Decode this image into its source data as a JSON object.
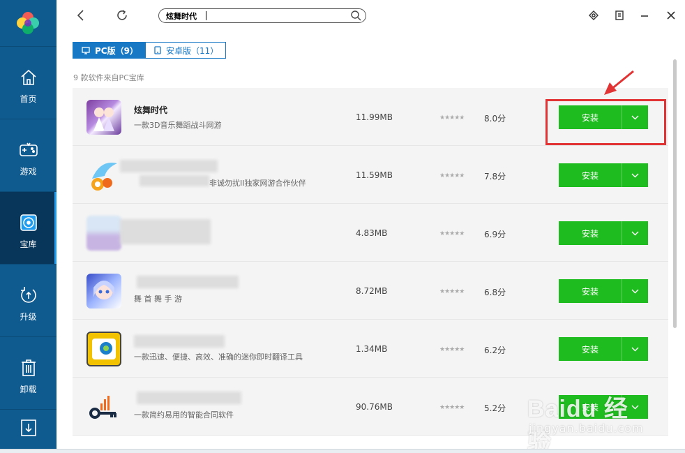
{
  "colors": {
    "sidebar": "#0f5a8f",
    "sidebar_active": "#08365a",
    "accent_blue": "#1778c6",
    "install_green": "#1fbc1f",
    "annotation_red": "#e13333"
  },
  "sidebar": {
    "logo_icon": "app-logo-icon",
    "items": [
      {
        "label": "首页",
        "icon": "home-icon",
        "active": false
      },
      {
        "label": "游戏",
        "icon": "gamepad-icon",
        "active": false
      },
      {
        "label": "宝库",
        "icon": "disc-icon",
        "active": true
      },
      {
        "label": "升级",
        "icon": "upgrade-icon",
        "active": false
      },
      {
        "label": "卸载",
        "icon": "trash-icon",
        "active": false
      },
      {
        "label": "",
        "icon": "download-icon",
        "active": false
      }
    ]
  },
  "topbar": {
    "back_icon": "chevron-left-icon",
    "refresh_icon": "refresh-icon",
    "search_value": "炫舞时代",
    "search_icon": "search-icon",
    "right_icons": [
      "network-icon",
      "skin-icon",
      "minimize-icon",
      "close-icon"
    ]
  },
  "tabs": [
    {
      "label": "PC版（9）",
      "icon": "monitor-icon",
      "active": true
    },
    {
      "label": "安卓版（11）",
      "icon": "phone-icon",
      "active": false
    }
  ],
  "source_line": "9 款软件来自PC宝库",
  "apps": [
    {
      "name": "炫舞时代",
      "desc": "一款3D音乐舞蹈战斗网游",
      "size": "11.99MB",
      "stars": "★★★★★",
      "score": "8.0分",
      "install": "安装"
    },
    {
      "name": "",
      "desc": "非诚勿扰II独家网游合作伙伴",
      "size": "11.59MB",
      "stars": "★★★★★",
      "score": "7.8分",
      "install": "安装"
    },
    {
      "name": "",
      "desc": "",
      "size": "4.83MB",
      "stars": "★★★★★",
      "score": "6.9分",
      "install": "安装"
    },
    {
      "name": "",
      "desc": "舞   首 舞 手 游",
      "size": "8.72MB",
      "stars": "★★★★★",
      "score": "6.8分",
      "install": "安装"
    },
    {
      "name": "",
      "desc": "一款迅速、便捷、高效、准确的迷你即时翻译工具",
      "size": "1.34MB",
      "stars": "★★★★★",
      "score": "6.2分",
      "install": "安装"
    },
    {
      "name": "",
      "desc": "一款简约易用的智能合同软件",
      "size": "90.76MB",
      "stars": "★★★★★",
      "score": "5.2分",
      "install": "安装"
    }
  ],
  "watermark": {
    "brand": "Baidu 经验",
    "domain": "jingyan.baidu.com"
  }
}
